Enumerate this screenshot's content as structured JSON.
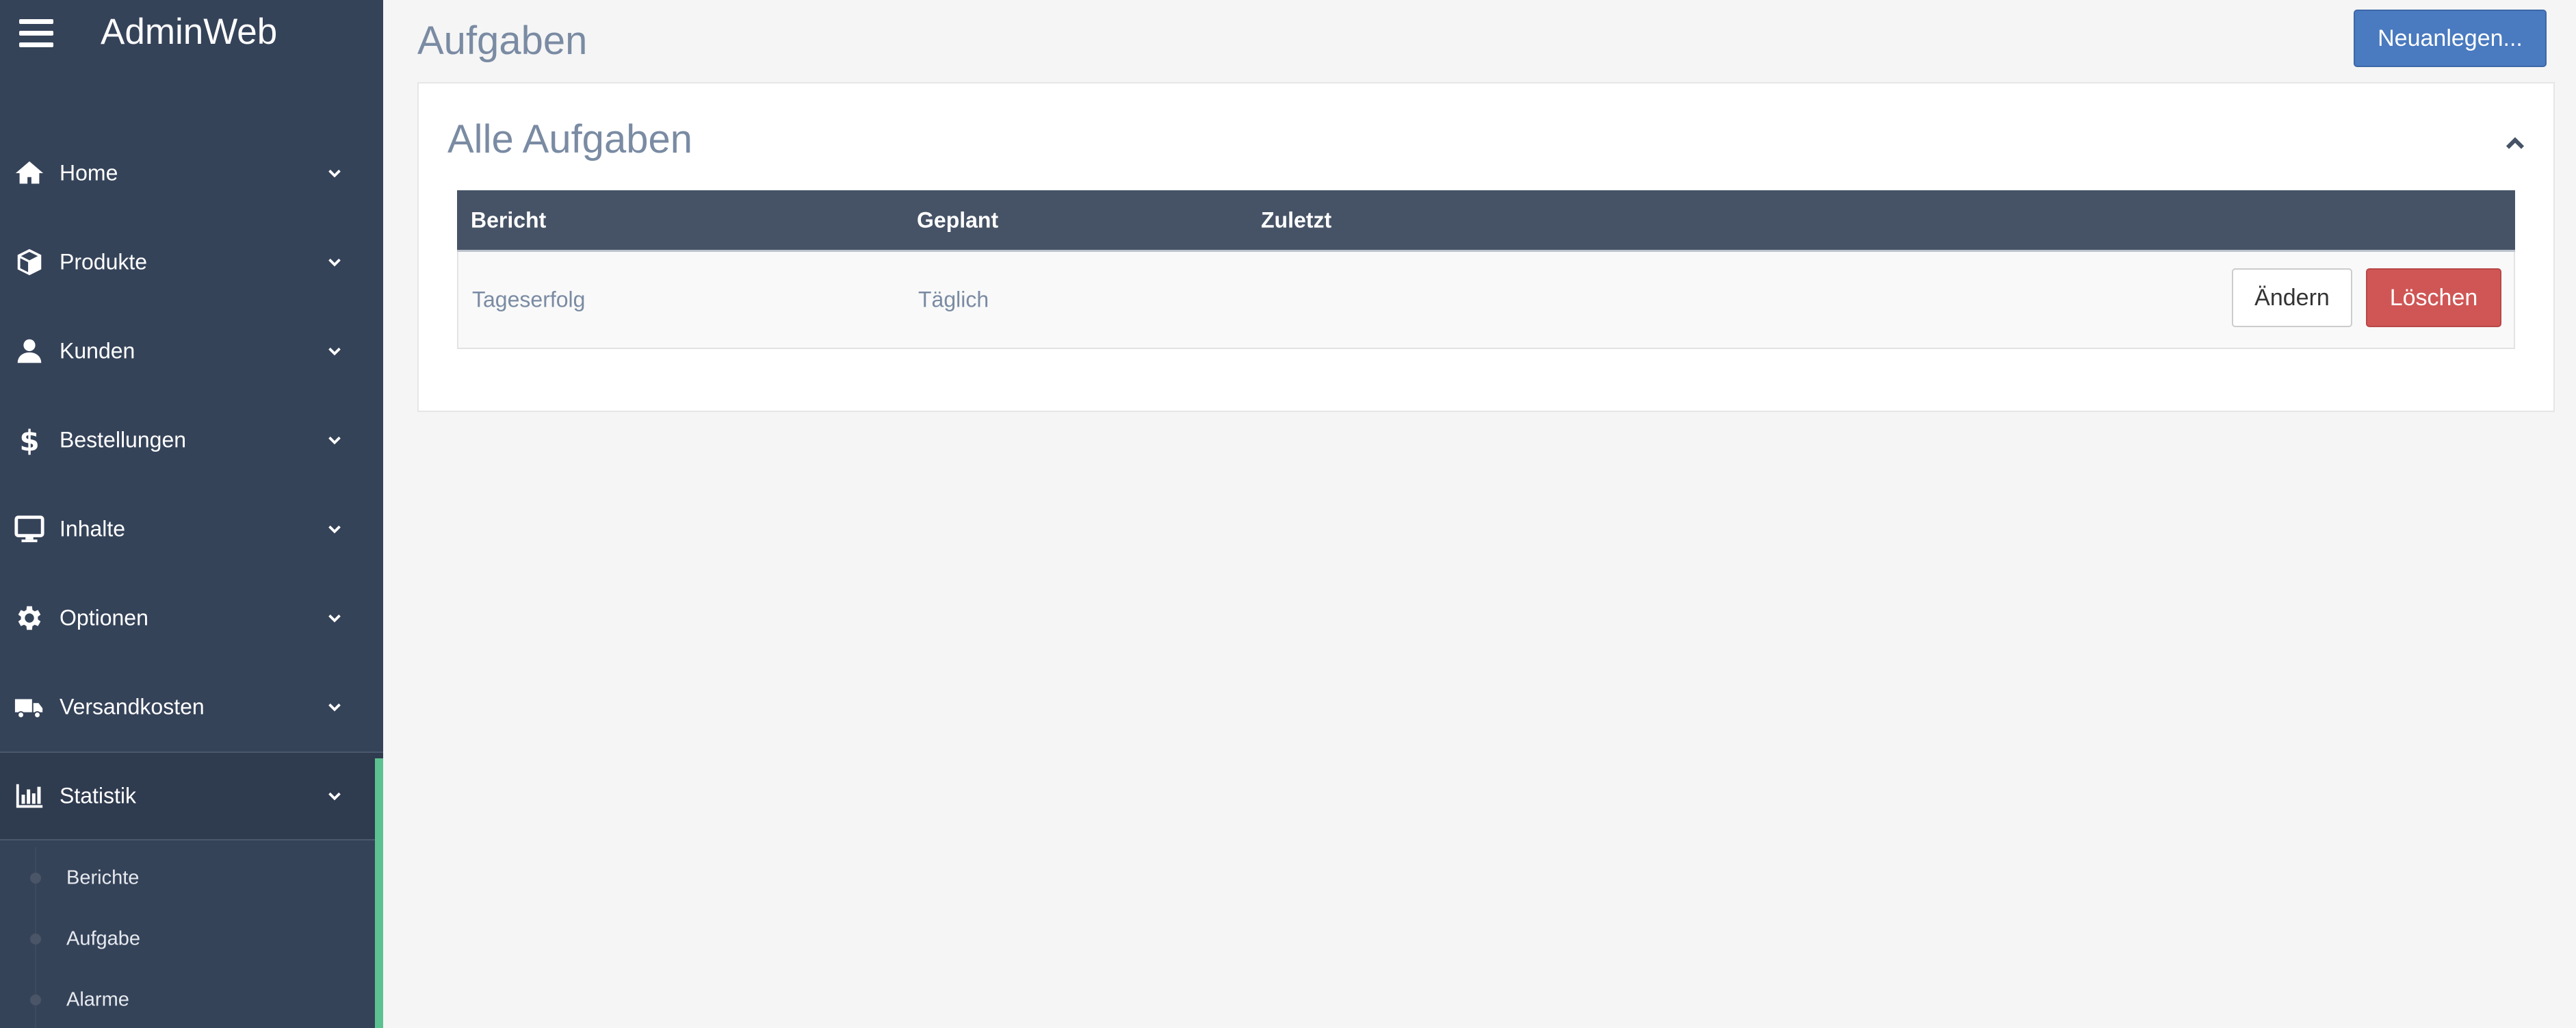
{
  "app": {
    "brand": "AdminWeb"
  },
  "sidebar": {
    "items": [
      {
        "label": "Home",
        "icon": "home-icon"
      },
      {
        "label": "Produkte",
        "icon": "box-icon"
      },
      {
        "label": "Kunden",
        "icon": "user-icon"
      },
      {
        "label": "Bestellungen",
        "icon": "dollar-icon"
      },
      {
        "label": "Inhalte",
        "icon": "monitor-icon"
      },
      {
        "label": "Optionen",
        "icon": "gear-icon"
      },
      {
        "label": "Versandkosten",
        "icon": "truck-icon"
      },
      {
        "label": "Statistik",
        "icon": "bar-chart-icon",
        "active": true
      }
    ],
    "submenu": [
      {
        "label": "Berichte"
      },
      {
        "label": "Aufgabe"
      },
      {
        "label": "Alarme"
      }
    ]
  },
  "header": {
    "title": "Aufgaben",
    "new_button": "Neuanlegen..."
  },
  "panel": {
    "title": "Alle Aufgaben",
    "table": {
      "columns": [
        "Bericht",
        "Geplant",
        "Zuletzt"
      ],
      "rows": [
        {
          "bericht": "Tageserfolg",
          "geplant": "Täglich",
          "zuletzt": "",
          "edit_label": "Ändern",
          "delete_label": "Löschen"
        }
      ]
    }
  },
  "colors": {
    "sidebar_bg": "#354359",
    "accent_green": "#5cc191",
    "primary_button": "#4a7abf",
    "danger_button": "#cf5655",
    "table_header": "#465366"
  }
}
